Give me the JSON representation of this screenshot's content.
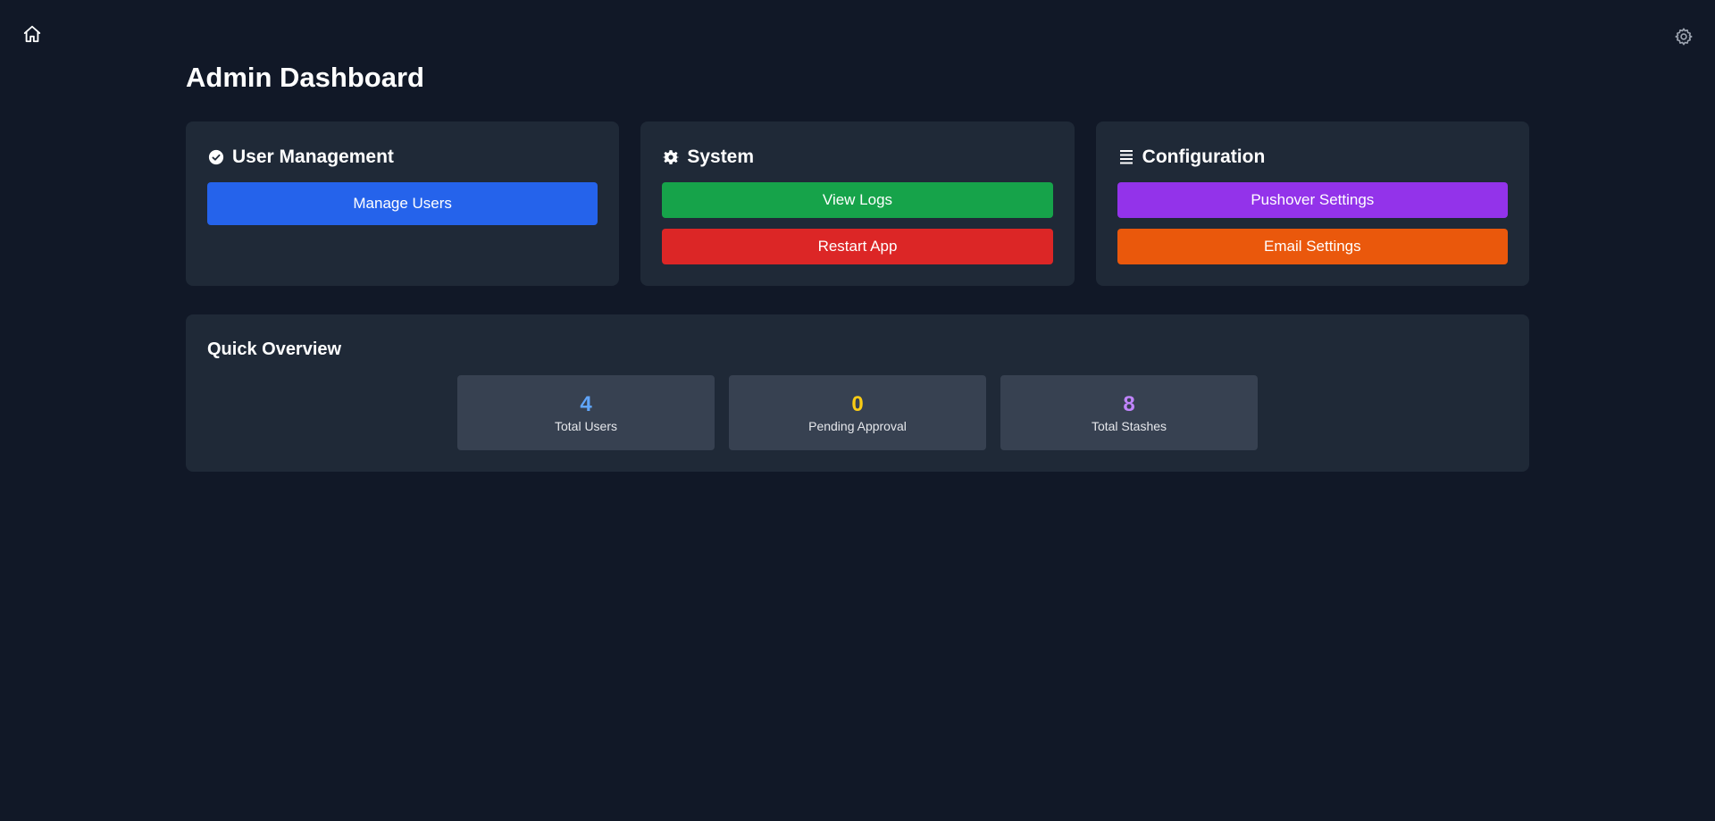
{
  "header": {
    "home_icon": "home-icon",
    "settings_icon": "gear-icon"
  },
  "page": {
    "title": "Admin Dashboard"
  },
  "cards": {
    "user_management": {
      "title": "User Management",
      "icon": "user-check-icon",
      "buttons": [
        {
          "label": "Manage Users",
          "color": "#2563eb"
        }
      ]
    },
    "system": {
      "title": "System",
      "icon": "gear-icon",
      "buttons": [
        {
          "label": "View Logs",
          "color": "#16a34a"
        },
        {
          "label": "Restart App",
          "color": "#dc2626"
        }
      ]
    },
    "configuration": {
      "title": "Configuration",
      "icon": "list-icon",
      "buttons": [
        {
          "label": "Pushover Settings",
          "color": "#9333ea"
        },
        {
          "label": "Email Settings",
          "color": "#ea580c"
        }
      ]
    }
  },
  "overview": {
    "title": "Quick Overview",
    "stats": [
      {
        "value": "4",
        "label": "Total Users",
        "color": "#60a5fa"
      },
      {
        "value": "0",
        "label": "Pending Approval",
        "color": "#facc15"
      },
      {
        "value": "8",
        "label": "Total Stashes",
        "color": "#c084fc"
      }
    ]
  }
}
